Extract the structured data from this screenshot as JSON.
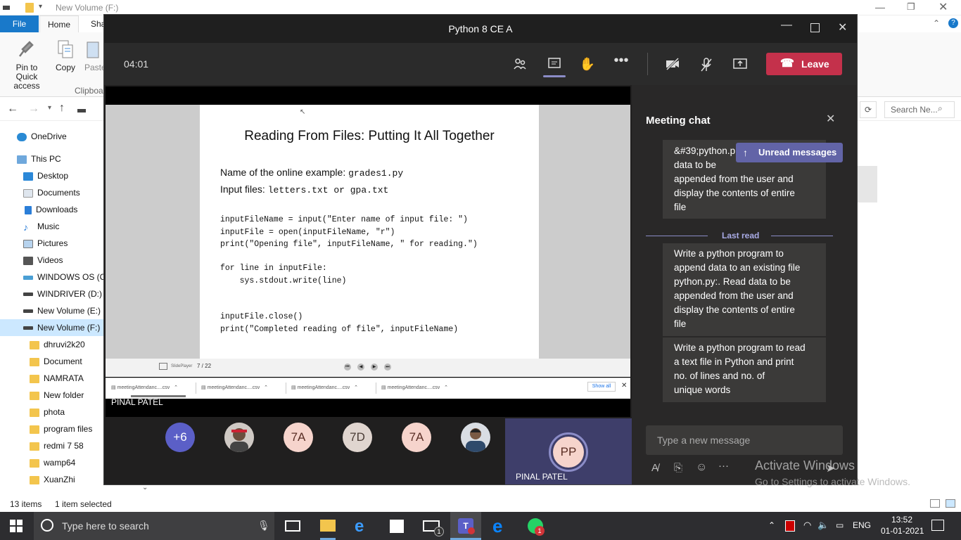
{
  "explorer": {
    "window_title": "New Volume (F:)",
    "tabs": [
      "File",
      "Home",
      "Sha"
    ],
    "ribbon": {
      "pin": "Pin to Quick access",
      "copy": "Copy",
      "paste": "Paste",
      "group": "Clipboard"
    },
    "search_placeholder": "Search Ne...",
    "nav_items": [
      "OneDrive",
      "This PC",
      "Desktop",
      "Documents",
      "Downloads",
      "Music",
      "Pictures",
      "Videos",
      "WINDOWS OS (C:",
      "WINDRIVER (D:)",
      "New Volume (E:)",
      "New Volume (F:)",
      "dhruvi2k20",
      "Document",
      "NAMRATA",
      "New folder",
      "phota",
      "program files",
      "redmi 7 58",
      "wamp64",
      "XuanZhi"
    ],
    "status_items": "13 items",
    "status_selected": "1 item selected"
  },
  "teams": {
    "title": "Python 8 CE A",
    "timer": "04:01",
    "leave_label": "Leave",
    "presenter_name": "PINAL PATEL",
    "slide": {
      "title": "Reading From Files: Putting It All Together",
      "line1_label": "Name of the online example:",
      "line1_code": "grades1.py",
      "line2_label": "Input files:",
      "line2_code": "letters.txt or gpa.txt",
      "code1": "inputFileName = input(\"Enter name of input file: \")\ninputFile = open(inputFileName, \"r\")\nprint(\"Opening file\", inputFileName, \" for reading.\")",
      "code2": "for line in inputFile:\n    sys.stdout.write(line)",
      "code3": "inputFile.close()\nprint(\"Completed reading of file\", inputFileName)"
    },
    "slideplayer": {
      "brand": "SlidePlayer",
      "page": "7 / 22"
    },
    "downloads": {
      "files": [
        "meetingAttendanc....csv",
        "meetingAttendanc....csv",
        "meetingAttendanc....csv",
        "meetingAttendanc....csv"
      ],
      "show_all": "Show all"
    },
    "gallery": {
      "more": "+6",
      "avatars": [
        "7A",
        "7D",
        "7A"
      ],
      "active_initials": "PP",
      "active_name": "PINAL PATEL"
    },
    "chat": {
      "title": "Meeting chat",
      "unread_label": "Unread messages",
      "msg0": "&#39;python.p\ndata to be\nappended from the user and\ndisplay the contents of entire\nfile",
      "last_read": "Last read",
      "msg1": "Write a python program to\nappend data to an existing file\npython.py:. Read data to be\nappended from the user and\ndisplay the contents of entire\nfile",
      "msg2": "Write a python program to read\na text file in Python and print\nno. of lines and no. of\nunique words",
      "compose_placeholder": "Type a new message"
    }
  },
  "watermark": {
    "line1": "Activate Windows",
    "line2": "Go to Settings to activate Windows."
  },
  "taskbar": {
    "search_placeholder": "Type here to search",
    "lang": "ENG",
    "time": "13:52",
    "date": "01-01-2021",
    "badge_mail": "1",
    "badge_whatsapp": "1"
  },
  "colors": {
    "teams_purple": "#6264a7",
    "leave_red": "#c4314b",
    "explorer_blue": "#0078d7"
  }
}
